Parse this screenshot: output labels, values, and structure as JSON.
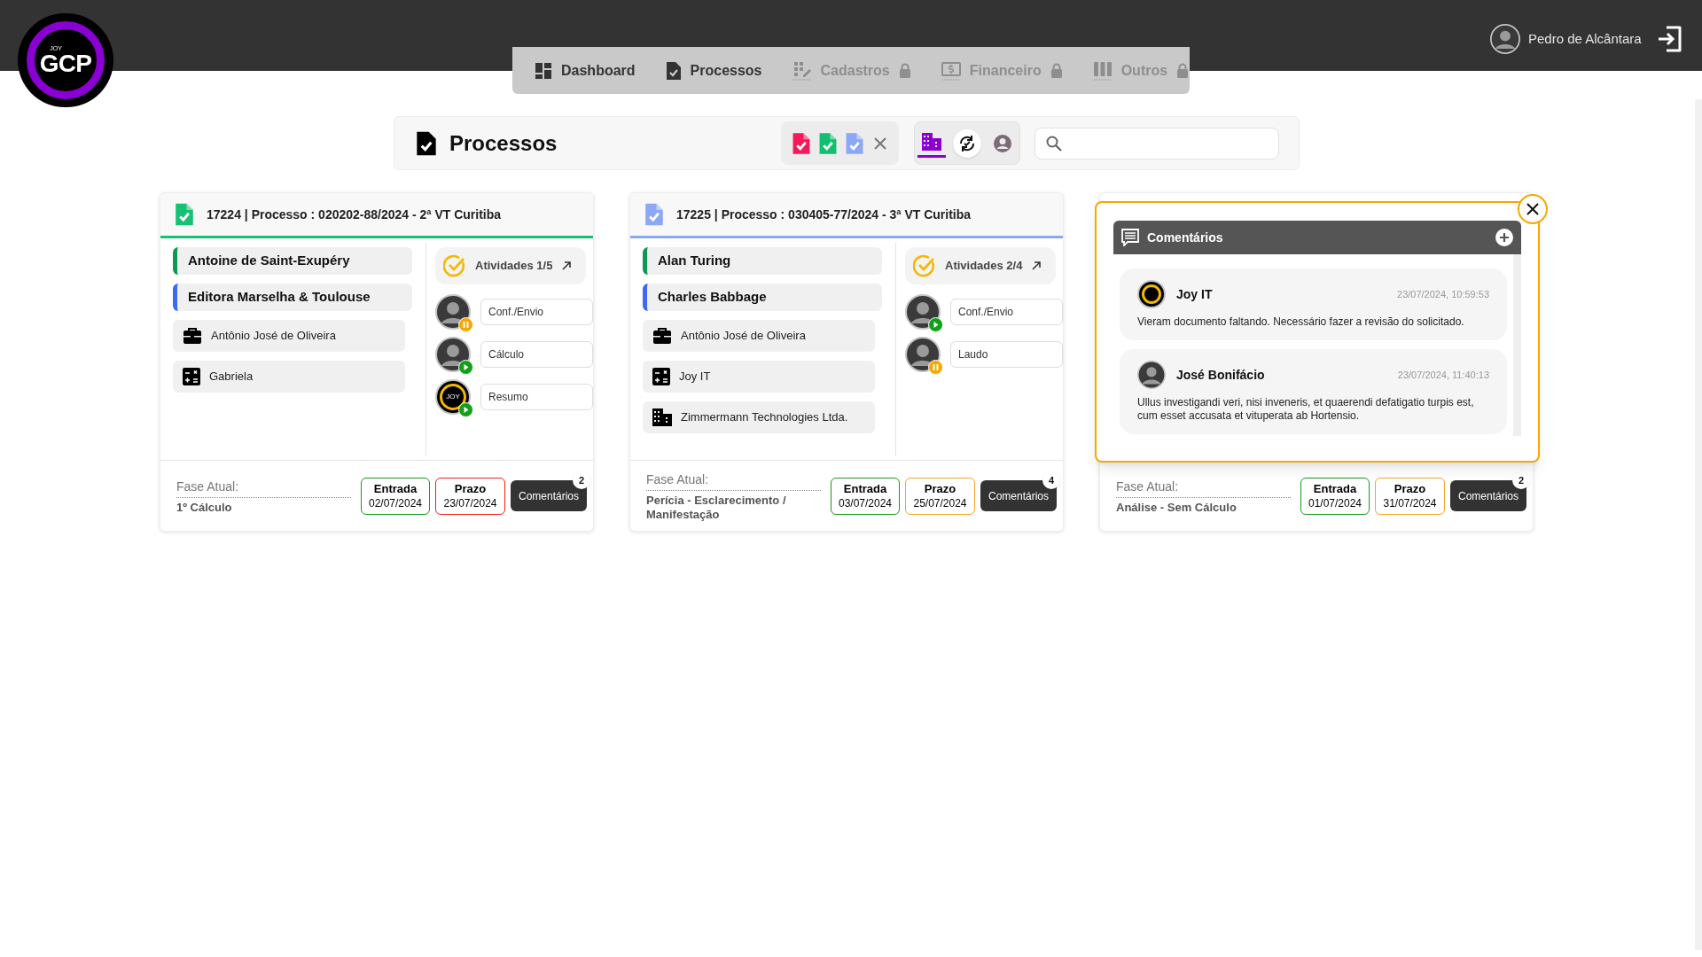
{
  "header": {
    "logo": {
      "small": "JOY",
      "main": "GCP"
    },
    "user": {
      "name": "Pedro de Alcântara"
    }
  },
  "nav": [
    {
      "label": "Dashboard",
      "locked": false
    },
    {
      "label": "Processos",
      "locked": false
    },
    {
      "label": "Cadastros",
      "locked": true
    },
    {
      "label": "Financeiro",
      "locked": true
    },
    {
      "label": "Outros",
      "locked": true
    }
  ],
  "toolbar": {
    "title": "Processos",
    "filters": [
      {
        "color": "#f5195b"
      },
      {
        "color": "#10c070"
      },
      {
        "color": "#8aa8f5"
      }
    ],
    "views": [
      {
        "selected": true
      },
      {
        "selected": false
      },
      {
        "selected": false
      }
    ]
  },
  "cards": [
    {
      "title": "17224 | Processo : 020202-88/2024 - 2ª VT Curitiba",
      "color": "#16c172",
      "parties": [
        {
          "name": "Antoine de Saint-Exupéry",
          "color": "#0a9a55"
        },
        {
          "name": "Editora Marselha & Toulouse",
          "color": "#3d6af5"
        }
      ],
      "details": [
        {
          "kind": "briefcase",
          "text": "Antônio José de Oliveira"
        },
        {
          "kind": "calculator",
          "text": "Gabriela"
        }
      ],
      "activities": {
        "label": "Atividades 1/5",
        "items": [
          {
            "label": "Conf./Envio",
            "kind": "photo",
            "paused": true
          },
          {
            "label": "Cálculo",
            "kind": "photo",
            "paused": false
          },
          {
            "label": "Resumo",
            "kind": "logo",
            "avatar_text": "JOY",
            "paused": false
          }
        ]
      },
      "footer": {
        "phase_label": "Fase Atual:",
        "phase": "1º Cálculo",
        "entry_label": "Entrada",
        "entry_date": "02/07/2024",
        "deadline": {
          "label": "Prazo",
          "date": "23/07/2024",
          "color": "#ef2020"
        },
        "comments_label": "Comentários",
        "comments_count": "2"
      }
    },
    {
      "title": "17225 | Processo : 030405-77/2024 - 3ª VT Curitiba",
      "color": "#8aa8f5",
      "parties": [
        {
          "name": "Alan Turing",
          "color": "#0a9a55"
        },
        {
          "name": "Charles Babbage",
          "color": "#3d6af5"
        }
      ],
      "details": [
        {
          "kind": "briefcase",
          "text": "Antônio José de Oliveira"
        },
        {
          "kind": "calculator",
          "text": "Joy IT"
        },
        {
          "kind": "building",
          "text": "Zimmermann Technologies Ltda."
        }
      ],
      "activities": {
        "label": "Atividades 2/4",
        "items": [
          {
            "label": "Conf./Envio",
            "kind": "photo",
            "paused": false
          },
          {
            "label": "Laudo",
            "kind": "photo",
            "paused": true
          }
        ]
      },
      "footer": {
        "phase_label": "Fase Atual:",
        "phase": "Perícia - Esclarecimento / Manifestação",
        "entry_label": "Entrada",
        "entry_date": "03/07/2024",
        "deadline": {
          "label": "Prazo",
          "date": "25/07/2024",
          "color": "#f5a623"
        },
        "comments_label": "Comentários",
        "comments_count": "4"
      }
    },
    {
      "footer": {
        "phase_label": "Fase Atual:",
        "phase": "Análise - Sem Cálculo",
        "entry_label": "Entrada",
        "entry_date": "01/07/2024",
        "deadline": {
          "label": "Prazo",
          "date": "31/07/2024",
          "color": "#f5a623"
        },
        "comments_label": "Comentários",
        "comments_count": "2"
      },
      "comments_panel": {
        "title": "Comentários",
        "comments": [
          {
            "author": "Joy IT",
            "kind": "logo",
            "time": "23/07/2024, 10:59:53",
            "text": "Vieram documento faltando. Necessário fazer a revisão do solicitado."
          },
          {
            "author": "José Bonifácio",
            "kind": "photo",
            "time": "23/07/2024, 11:40:13",
            "text": "Ullus investigandi veri, nisi inveneris, et quaerendi defatigatio turpis est, cum esset accusata et vituperata ab Hortensio."
          }
        ]
      }
    }
  ]
}
